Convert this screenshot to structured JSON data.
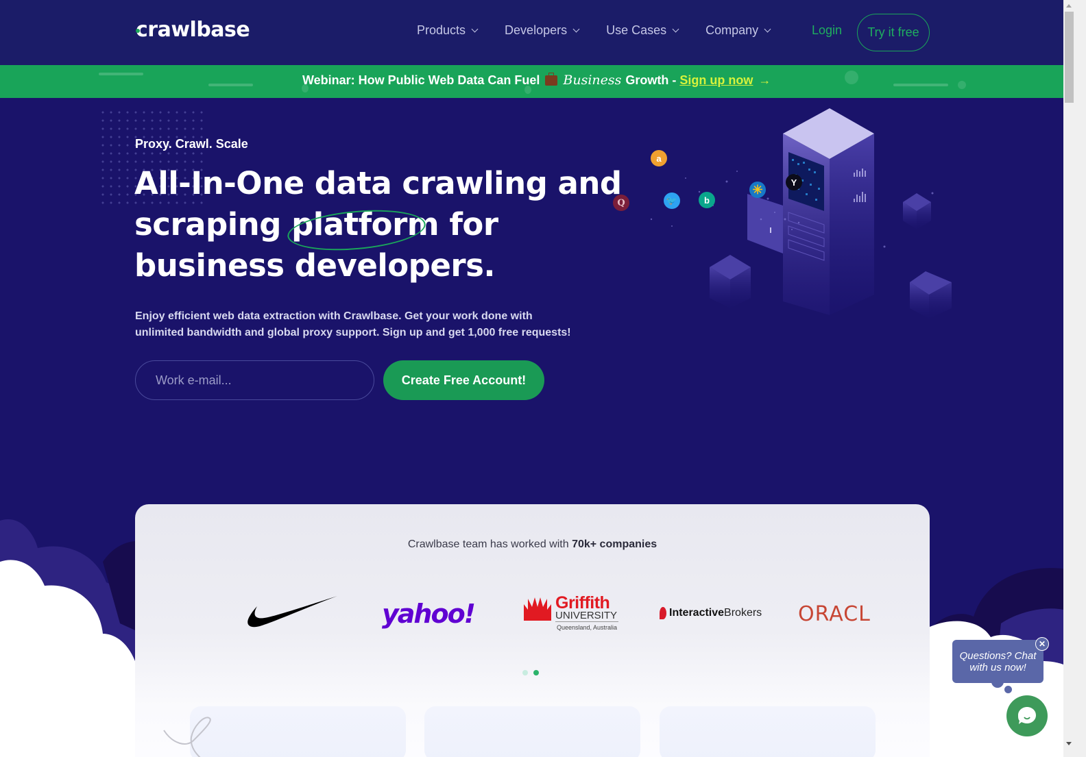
{
  "header": {
    "logo": "crawlbase",
    "nav": [
      {
        "label": "Products"
      },
      {
        "label": "Developers"
      },
      {
        "label": "Use Cases"
      },
      {
        "label": "Company"
      }
    ],
    "login_label": "Login",
    "try_label": "Try it free"
  },
  "banner": {
    "text_before": "Webinar: How Public Web Data Can Fuel",
    "icon": "briefcase-icon",
    "text_italic": "Business",
    "text_after": "Growth -",
    "link_label": "Sign up now",
    "arrow": "→"
  },
  "hero": {
    "tagline": "Proxy. Crawl. Scale",
    "headline_part1": "All-In-One data crawling and scraping ",
    "headline_highlight": "platform",
    "headline_part2": " for business developers.",
    "subtext": "Enjoy efficient web data extraction with Crawlbase. Get your work done with unlimited bandwidth and global proxy support. Sign up and get 1,000 free requests!",
    "email_placeholder": "Work e-mail...",
    "email_value": "",
    "cta_label": "Create Free Account!",
    "illustration_logos": [
      "Q",
      "a",
      "twitter",
      "bing",
      "walmart",
      "Y"
    ]
  },
  "companies": {
    "title_prefix": "Crawlbase team has worked with ",
    "title_bold": "70k+ companies",
    "logos": [
      {
        "name": "Nike",
        "text": ""
      },
      {
        "name": "Yahoo",
        "text": "yahoo!"
      },
      {
        "name": "Griffith University",
        "text": "Griffith",
        "sub": "UNIVERSITY",
        "sub2": "Queensland, Australia"
      },
      {
        "name": "Interactive Brokers",
        "text_bold": "Interactive",
        "text_light": "Brokers"
      },
      {
        "name": "Oracle",
        "text": "ORACL"
      }
    ],
    "carousel": {
      "pages": 2,
      "active": 2
    }
  },
  "chat": {
    "prompt": "Questions? Chat with us now!",
    "close": "✕"
  },
  "colors": {
    "primary_bg": "#1a136a",
    "header_bg": "#1b1c68",
    "accent_green": "#1aa65a",
    "banner_link": "#d6f23c",
    "chat_bubble": "#5a67a8"
  }
}
